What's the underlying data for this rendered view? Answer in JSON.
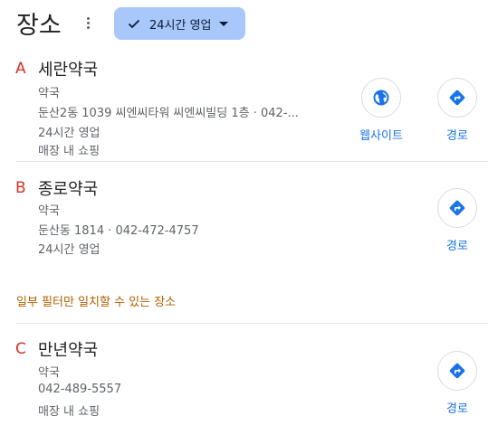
{
  "header": {
    "title": "장소",
    "chip_label": "24시간 영업"
  },
  "places": [
    {
      "letter": "A",
      "name": "세란약국",
      "category": "약국",
      "address": "둔산2동 1039 씨엔씨타워 씨엔씨빌딩 1층 · 042-...",
      "hours": "24시간 영업",
      "service": "매장 내 쇼핑",
      "website_label": "웹사이트",
      "directions_label": "경로"
    },
    {
      "letter": "B",
      "name": "종로약국",
      "category": "약국",
      "address": "둔산동 1814 · 042-472-4757",
      "hours": "24시간 영업",
      "directions_label": "경로"
    },
    {
      "letter": "C",
      "name": "만년약국",
      "category": "약국",
      "phone": "042-489-5557",
      "service": "매장 내 쇼핑",
      "directions_label": "경로"
    }
  ],
  "filter_note": "일부 필터만 일치할 수 있는 장소",
  "colors": {
    "chip_bg": "#a8c7fa",
    "letter": "#d93025",
    "link": "#1a73e8",
    "note": "#b06000"
  },
  "icons": [
    "more-vert-icon",
    "check-icon",
    "dropdown-arrow-icon",
    "globe-icon",
    "directions-icon"
  ]
}
